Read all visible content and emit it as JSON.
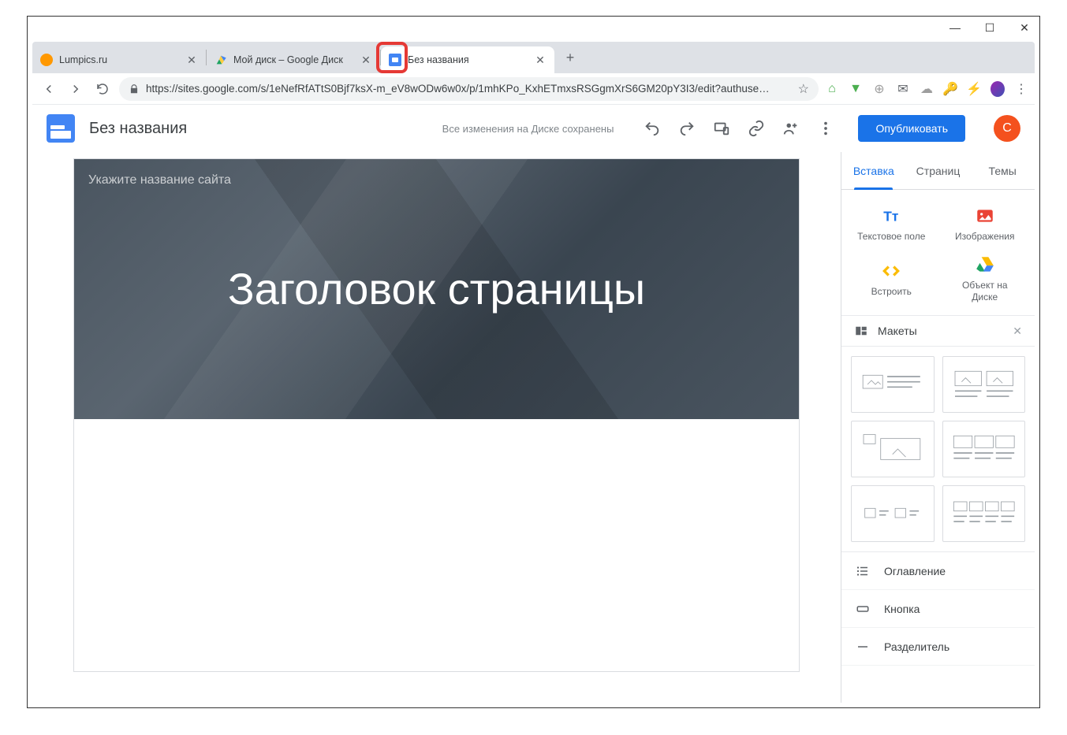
{
  "window_controls": {
    "min": "—",
    "max": "☐",
    "close": "✕"
  },
  "tabs": [
    {
      "title": "Lumpics.ru",
      "active": false
    },
    {
      "title": "Мой диск – Google Диск",
      "active": false
    },
    {
      "title": "Без названия",
      "active": true
    }
  ],
  "newtab": "+",
  "url": "https://sites.google.com/s/1eNefRfATtS0Bjf7ksX-m_eV8wODw6w0x/p/1mhKPo_KxhETmxsRSGgmXrS6GM20pY3I3/edit?authuse…",
  "url_star": "☆",
  "ext_icons": {
    "home": "🏠",
    "shield": "🛡",
    "globe": "🌐",
    "mail": "✉",
    "cloud": "☁",
    "key": "🔑",
    "bolt": "⚡"
  },
  "app": {
    "doc_title": "Без названия",
    "save_status": "Все изменения на Диске сохранены",
    "publish": "Опубликовать",
    "avatar": "С"
  },
  "canvas": {
    "site_name_placeholder": "Укажите название сайта",
    "hero_title": "Заголовок страницы"
  },
  "sidepanel": {
    "tabs": {
      "insert": "Вставка",
      "pages": "Страниц",
      "themes": "Темы"
    },
    "insert_items": {
      "textbox": "Текстовое поле",
      "images": "Изображения",
      "embed": "Встроить",
      "drive_object_l1": "Объект на",
      "drive_object_l2": "Диске"
    },
    "layouts_label": "Макеты",
    "layouts_close": "✕",
    "list": {
      "toc": "Оглавление",
      "button": "Кнопка",
      "divider": "Разделитель"
    }
  }
}
